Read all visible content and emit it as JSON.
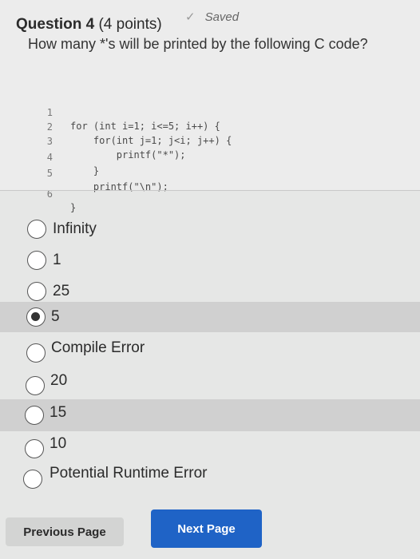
{
  "question": {
    "title": "Question 4",
    "points": "(4 points)",
    "saved_label": "Saved",
    "prompt": "How many *'s will be printed by the following C code?"
  },
  "code_lines": [
    {
      "num": "1",
      "text": "for (int i=1; i<=5; i++) {"
    },
    {
      "num": "2",
      "text": "    for(int j=1; j<i; j++) {"
    },
    {
      "num": "3",
      "text": "        printf(\"*\");"
    },
    {
      "num": "4",
      "text": "    }"
    },
    {
      "num": "5",
      "text": "    printf(\"\\n\");"
    },
    {
      "num": "6",
      "text": "}"
    }
  ],
  "options": [
    {
      "label": "Infinity",
      "selected": false
    },
    {
      "label": "1",
      "selected": false
    },
    {
      "label": "25",
      "selected": false
    },
    {
      "label": "5",
      "selected": true
    },
    {
      "label": "Compile Error",
      "selected": false
    },
    {
      "label": "20",
      "selected": false
    },
    {
      "label": "15",
      "selected": false
    },
    {
      "label": "10",
      "selected": false
    },
    {
      "label": "Potential Runtime Error",
      "selected": false
    }
  ],
  "nav": {
    "previous_label": "Previous Page",
    "next_label": "Next Page"
  },
  "colors": {
    "next_button": "#1f63c6",
    "background": "#e6e7e6"
  }
}
